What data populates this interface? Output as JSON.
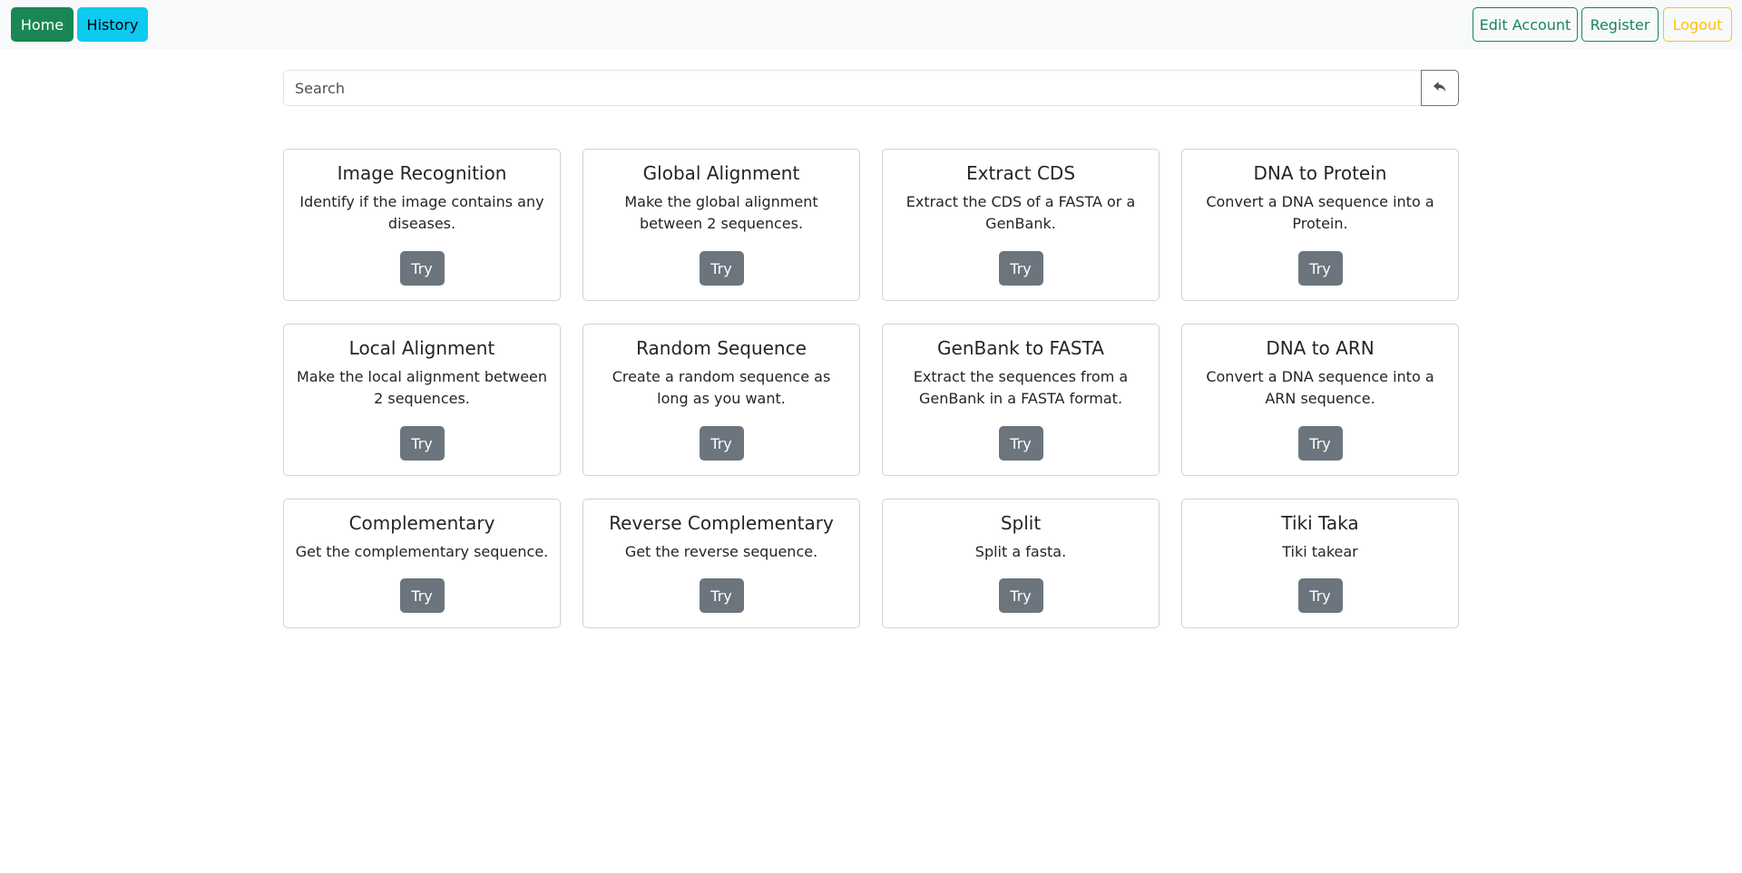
{
  "nav": {
    "home": "Home",
    "history": "History",
    "edit_account": "Edit Account",
    "register": "Register",
    "logout": "Logout"
  },
  "search": {
    "placeholder": "Search",
    "button_icon": "reply-arrow-icon"
  },
  "cards": [
    {
      "title": "Image Recognition",
      "text": "Identify if the image contains any diseases.",
      "button": "Try"
    },
    {
      "title": "Global Alignment",
      "text": "Make the global alignment between 2 sequences.",
      "button": "Try"
    },
    {
      "title": "Extract CDS",
      "text": "Extract the CDS of a FASTA or a GenBank.",
      "button": "Try"
    },
    {
      "title": "DNA to Protein",
      "text": "Convert a DNA sequence into a Protein.",
      "button": "Try"
    },
    {
      "title": "Local Alignment",
      "text": "Make the local alignment between 2 sequences.",
      "button": "Try"
    },
    {
      "title": "Random Sequence",
      "text": "Create a random sequence as long as you want.",
      "button": "Try"
    },
    {
      "title": "GenBank to FASTA",
      "text": "Extract the sequences from a GenBank in a FASTA format.",
      "button": "Try"
    },
    {
      "title": "DNA to ARN",
      "text": "Convert a DNA sequence into a ARN sequence.",
      "button": "Try"
    },
    {
      "title": "Complementary",
      "text": "Get the complementary sequence.",
      "button": "Try"
    },
    {
      "title": "Reverse Complementary",
      "text": "Get the reverse sequence.",
      "button": "Try"
    },
    {
      "title": "Split",
      "text": "Split a fasta.",
      "button": "Try"
    },
    {
      "title": "Tiki Taka",
      "text": "Tiki takear",
      "button": "Try"
    }
  ],
  "colors": {
    "home": "#198754",
    "history": "#0dcaf0",
    "outline_success": "#198754",
    "outline_warning": "#ffc107",
    "try_button": "#6c757d"
  }
}
